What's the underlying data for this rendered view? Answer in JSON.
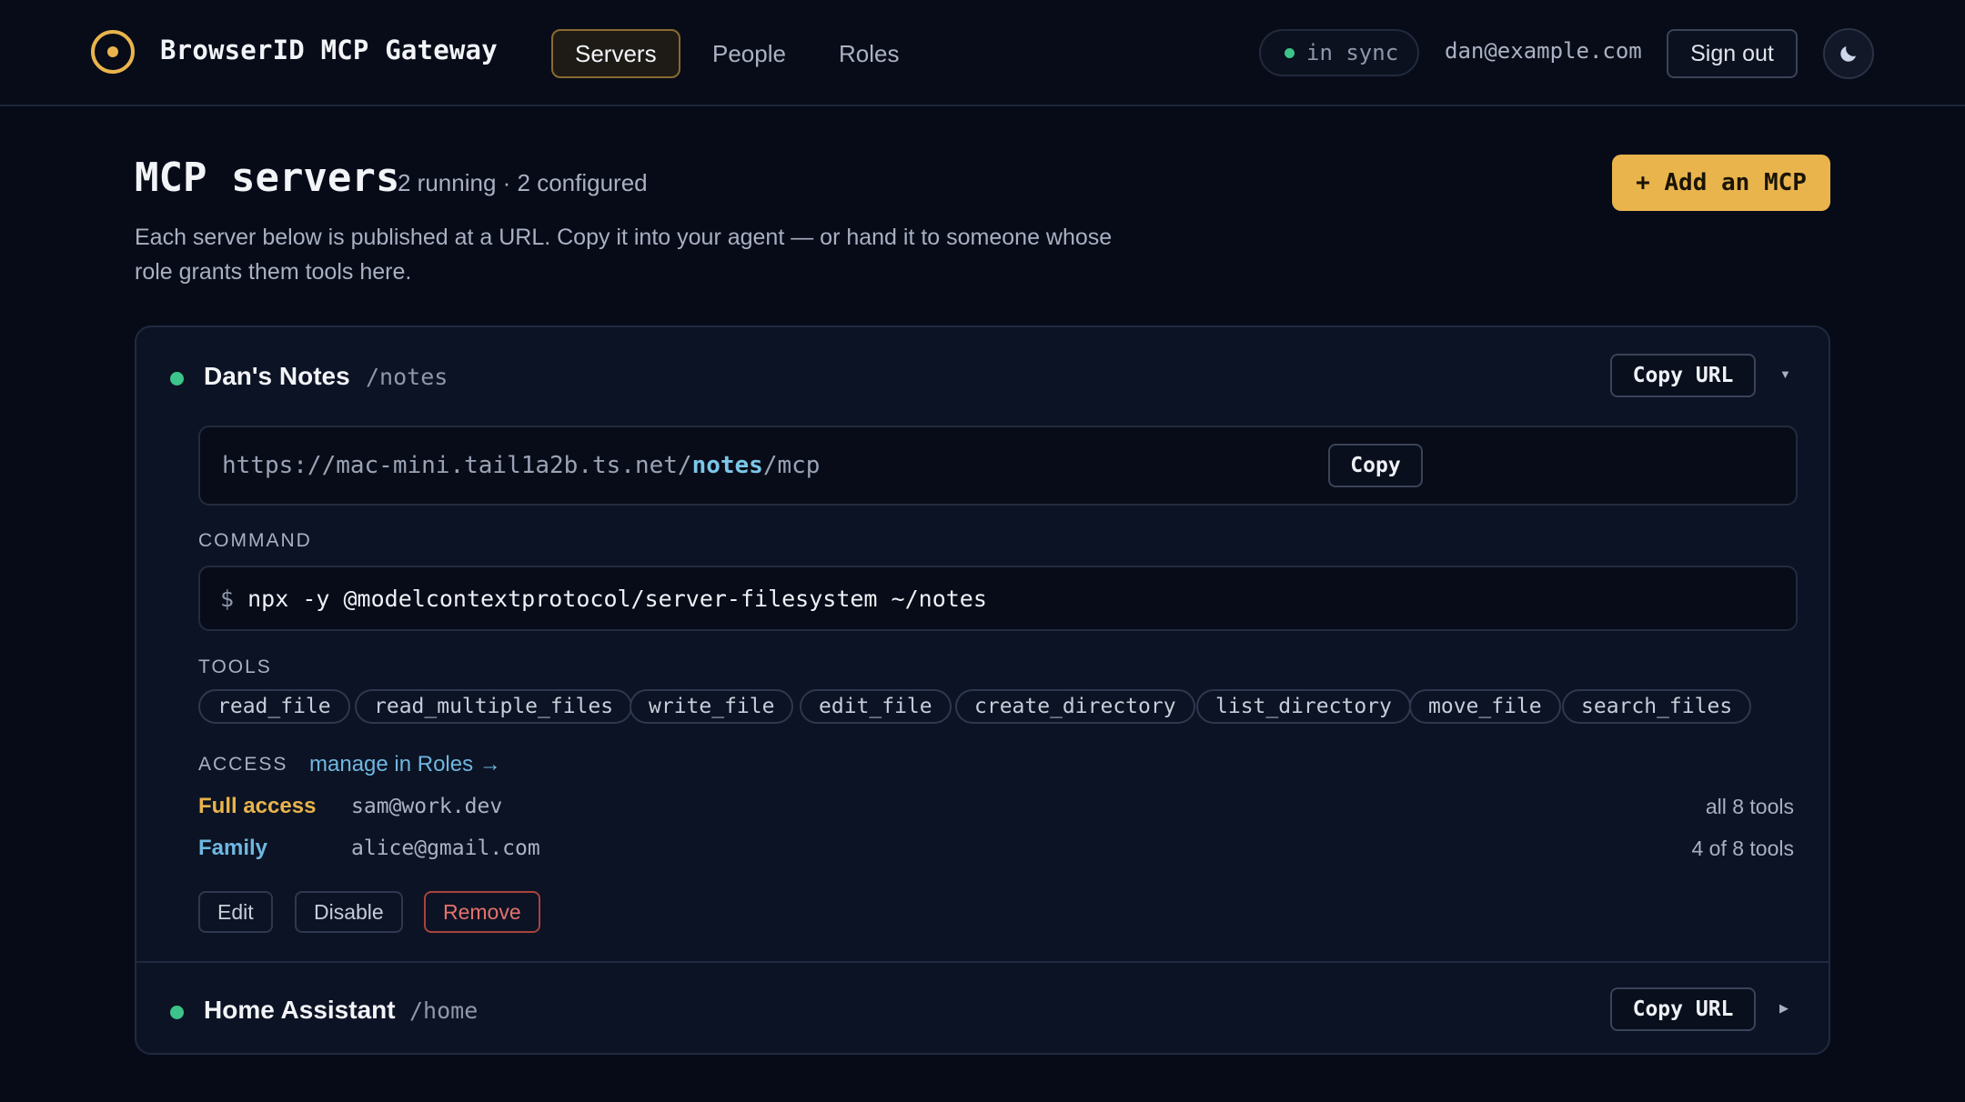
{
  "app": {
    "title": "BrowserID MCP Gateway",
    "accent_color": "#e9b44c",
    "logo_icon": "target-icon"
  },
  "nav": {
    "items": [
      {
        "label": "Servers",
        "active": true
      },
      {
        "label": "People",
        "active": false
      },
      {
        "label": "Roles",
        "active": false
      }
    ]
  },
  "status": {
    "sync_label": "in sync",
    "sync_color": "#3cc48a"
  },
  "user": {
    "email": "dan@example.com",
    "sign_out_label": "Sign out",
    "theme_icon": "moon-icon"
  },
  "page": {
    "title": "MCP servers",
    "counts": "2 running · 2 configured",
    "description": "Each server below is published at a URL. Copy it into your agent — or hand it to someone whose role grants them tools here.",
    "add_button_label": "+ Add an MCP"
  },
  "servers": [
    {
      "name": "Dan's Notes",
      "path": "/notes",
      "running": true,
      "expanded": true,
      "copy_url_label": "Copy URL",
      "url": {
        "prefix": "https://mac-mini.tail1a2b.ts.net/",
        "highlight": "notes",
        "suffix": "/mcp"
      },
      "copy_label": "Copy",
      "command_label": "COMMAND",
      "command_prompt": "$",
      "command": "npx -y @modelcontextprotocol/server-filesystem ~/notes",
      "tools_label": "TOOLS",
      "tools": [
        "read_file",
        "read_multiple_files",
        "write_file",
        "edit_file",
        "create_directory",
        "list_directory",
        "move_file",
        "search_files"
      ],
      "access_label": "ACCESS",
      "access_link": "manage in Roles →",
      "access": [
        {
          "role": "Full access",
          "email": "sam@work.dev",
          "tools": "all 8 tools",
          "color": "#e9b44c"
        },
        {
          "role": "Family",
          "email": "alice@gmail.com",
          "tools": "4 of 8 tools",
          "color": "#6fb7e0"
        }
      ],
      "actions": {
        "edit": "Edit",
        "disable": "Disable",
        "remove": "Remove"
      }
    },
    {
      "name": "Home Assistant",
      "path": "/home",
      "running": true,
      "expanded": false,
      "copy_url_label": "Copy URL"
    }
  ]
}
